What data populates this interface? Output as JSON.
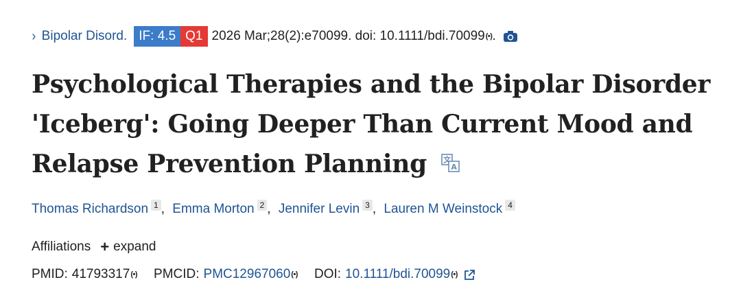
{
  "citation": {
    "chevron": "›",
    "journal": "Bipolar Disord.",
    "impact_factor": "IF: 4.5",
    "quartile": "Q1",
    "details": "2026 Mar;28(2):e70099. doi: 10.1111/bdi.70099",
    "signal_mark": "(•)",
    "period": ".",
    "camera_icon": "camera-icon"
  },
  "article": {
    "title": "Psychological Therapies and the Bipolar Disorder 'Iceberg': Going Deeper Than Current Mood and Relapse Prevention Planning",
    "translate_icon": "translate-icon"
  },
  "authors": [
    {
      "name": "Thomas Richardson",
      "aff": "1"
    },
    {
      "name": "Emma Morton",
      "aff": "2"
    },
    {
      "name": "Jennifer Levin",
      "aff": "3"
    },
    {
      "name": "Lauren M Weinstock",
      "aff": "4"
    }
  ],
  "affiliations": {
    "label": "Affiliations",
    "plus": "+",
    "expand": "expand"
  },
  "identifiers": {
    "pmid_label": "PMID:",
    "pmid": "41793317",
    "pmcid_label": "PMCID:",
    "pmcid": "PMC12967060",
    "doi_label": "DOI:",
    "doi": "10.1111/bdi.70099",
    "signal_mark": "(•)",
    "external_icon": "external-link-icon"
  },
  "colors": {
    "link": "#205493",
    "if_badge": "#3c7cc9",
    "q_badge": "#e53935",
    "text": "#212121"
  }
}
